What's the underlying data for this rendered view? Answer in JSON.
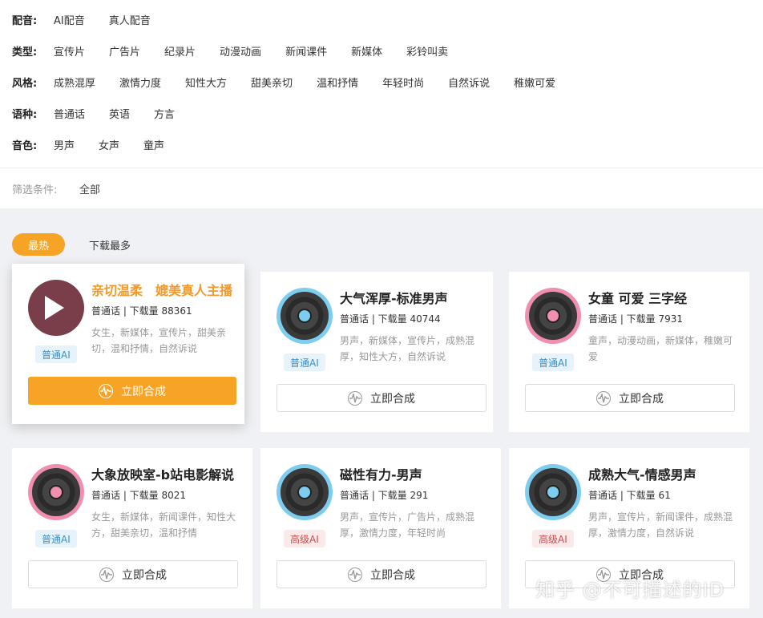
{
  "filters": {
    "dubbing": {
      "label": "配音:",
      "options": [
        "AI配音",
        "真人配音"
      ]
    },
    "type": {
      "label": "类型:",
      "options": [
        "宣传片",
        "广告片",
        "纪录片",
        "动漫动画",
        "新闻课件",
        "新媒体",
        "彩铃叫卖"
      ]
    },
    "style": {
      "label": "风格:",
      "options": [
        "成熟混厚",
        "激情力度",
        "知性大方",
        "甜美亲切",
        "温和抒情",
        "年轻时尚",
        "自然诉说",
        "稚嫩可爱"
      ]
    },
    "language": {
      "label": "语种:",
      "options": [
        "普通话",
        "英语",
        "方言"
      ]
    },
    "timbre": {
      "label": "音色:",
      "options": [
        "男声",
        "女声",
        "童声"
      ]
    },
    "condition": {
      "label": "筛选条件:",
      "value": "全部"
    }
  },
  "sort": {
    "hot": "最热",
    "downloads": "下载最多"
  },
  "cards": [
    {
      "title": "亲切温柔　媲美真人主播",
      "meta": "普通话 | 下载量 88361",
      "tags": "女生，新媒体，宣传片，甜美亲切，温和抒情，自然诉说",
      "badge": "普通AI",
      "button": "立即合成"
    },
    {
      "title": "大气浑厚-标准男声",
      "meta": "普通话 | 下载量 40744",
      "tags": "男声，新媒体，宣传片，成熟混厚，知性大方，自然诉说",
      "badge": "普通AI",
      "button": "立即合成"
    },
    {
      "title": "女童 可爱 三字经",
      "meta": "普通话 | 下载量 7931",
      "tags": "童声，动漫动画，新媒体，稚嫩可爱",
      "badge": "普通AI",
      "button": "立即合成"
    },
    {
      "title": "大象放映室-b站电影解说",
      "meta": "普通话 | 下载量 8021",
      "tags": "女生，新媒体，新闻课件，知性大方，甜美亲切，温和抒情",
      "badge": "普通AI",
      "button": "立即合成"
    },
    {
      "title": "磁性有力-男声",
      "meta": "普通话 | 下载量 291",
      "tags": "男声，宣传片，广告片，成熟混厚，激情力度，年轻时尚",
      "badge": "高级AI",
      "button": "立即合成"
    },
    {
      "title": "成熟大气-情感男声",
      "meta": "普通话 | 下载量 61",
      "tags": "男声，宣传片，新闻课件，成熟混厚，激情力度，自然诉说",
      "badge": "高级AI",
      "button": "立即合成"
    }
  ],
  "watermark": "知乎 @不可描述的ID",
  "colors": {
    "accent": "#f6a326",
    "blue_disc": "#7dcdf0",
    "pink_disc": "#f08fae"
  }
}
